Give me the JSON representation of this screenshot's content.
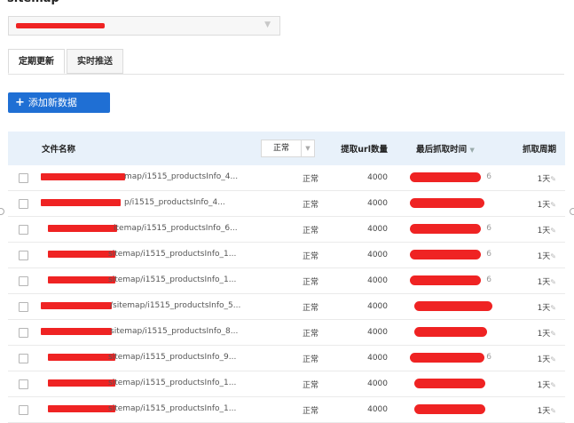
{
  "page_title": "sitemap",
  "tabs": [
    {
      "label": "定期更新"
    },
    {
      "label": "实时推送"
    }
  ],
  "add_button": {
    "label": "添加新数据"
  },
  "table": {
    "headers": {
      "filename": "文件名称",
      "status_filter": "正常",
      "count": "提取url数量",
      "last_time": "最后抓取时间",
      "period": "抓取周期"
    },
    "rows": [
      {
        "filename_suffix": "map/i1515_productsInfo_4...",
        "status": "正常",
        "count": "4000",
        "time_tail": "6",
        "period": "1天"
      },
      {
        "filename_suffix": "p/i1515_productsInfo_4...",
        "status": "正常",
        "count": "4000",
        "time_tail": "",
        "period": "1天"
      },
      {
        "filename_suffix": "itemap/i1515_productsInfo_6...",
        "status": "正常",
        "count": "4000",
        "time_tail": "6",
        "period": "1天"
      },
      {
        "filename_suffix": "sitemap/i1515_productsInfo_1...",
        "status": "正常",
        "count": "4000",
        "time_tail": "6",
        "period": "1天"
      },
      {
        "filename_suffix": "sitemap/i1515_productsInfo_1...",
        "status": "正常",
        "count": "4000",
        "time_tail": "6",
        "period": "1天"
      },
      {
        "filename_suffix": "/sitemap/i1515_productsInfo_5...",
        "status": "正常",
        "count": "4000",
        "time_tail": "",
        "period": "1天"
      },
      {
        "filename_suffix": "sitemap/i1515_productsInfo_8...",
        "status": "正常",
        "count": "4000",
        "time_tail": "",
        "period": "1天"
      },
      {
        "filename_suffix": "sitemap/i1515_productsInfo_9...",
        "status": "正常",
        "count": "4000",
        "time_tail": "6",
        "period": "1天"
      },
      {
        "filename_suffix": "sitemap/i1515_productsInfo_1...",
        "status": "正常",
        "count": "4000",
        "time_tail": "",
        "period": "1天"
      },
      {
        "filename_suffix": "sitemap/i1515_productsInfo_1...",
        "status": "正常",
        "count": "4000",
        "time_tail": "",
        "period": "1天"
      }
    ]
  },
  "icons": {
    "select_caret": "chevron-down-icon",
    "add": "plus-icon",
    "edit": "pencil-icon"
  },
  "colors": {
    "accent": "#1f6fd4",
    "header_bg": "#e8f1fa",
    "redaction": "#ef2323"
  }
}
